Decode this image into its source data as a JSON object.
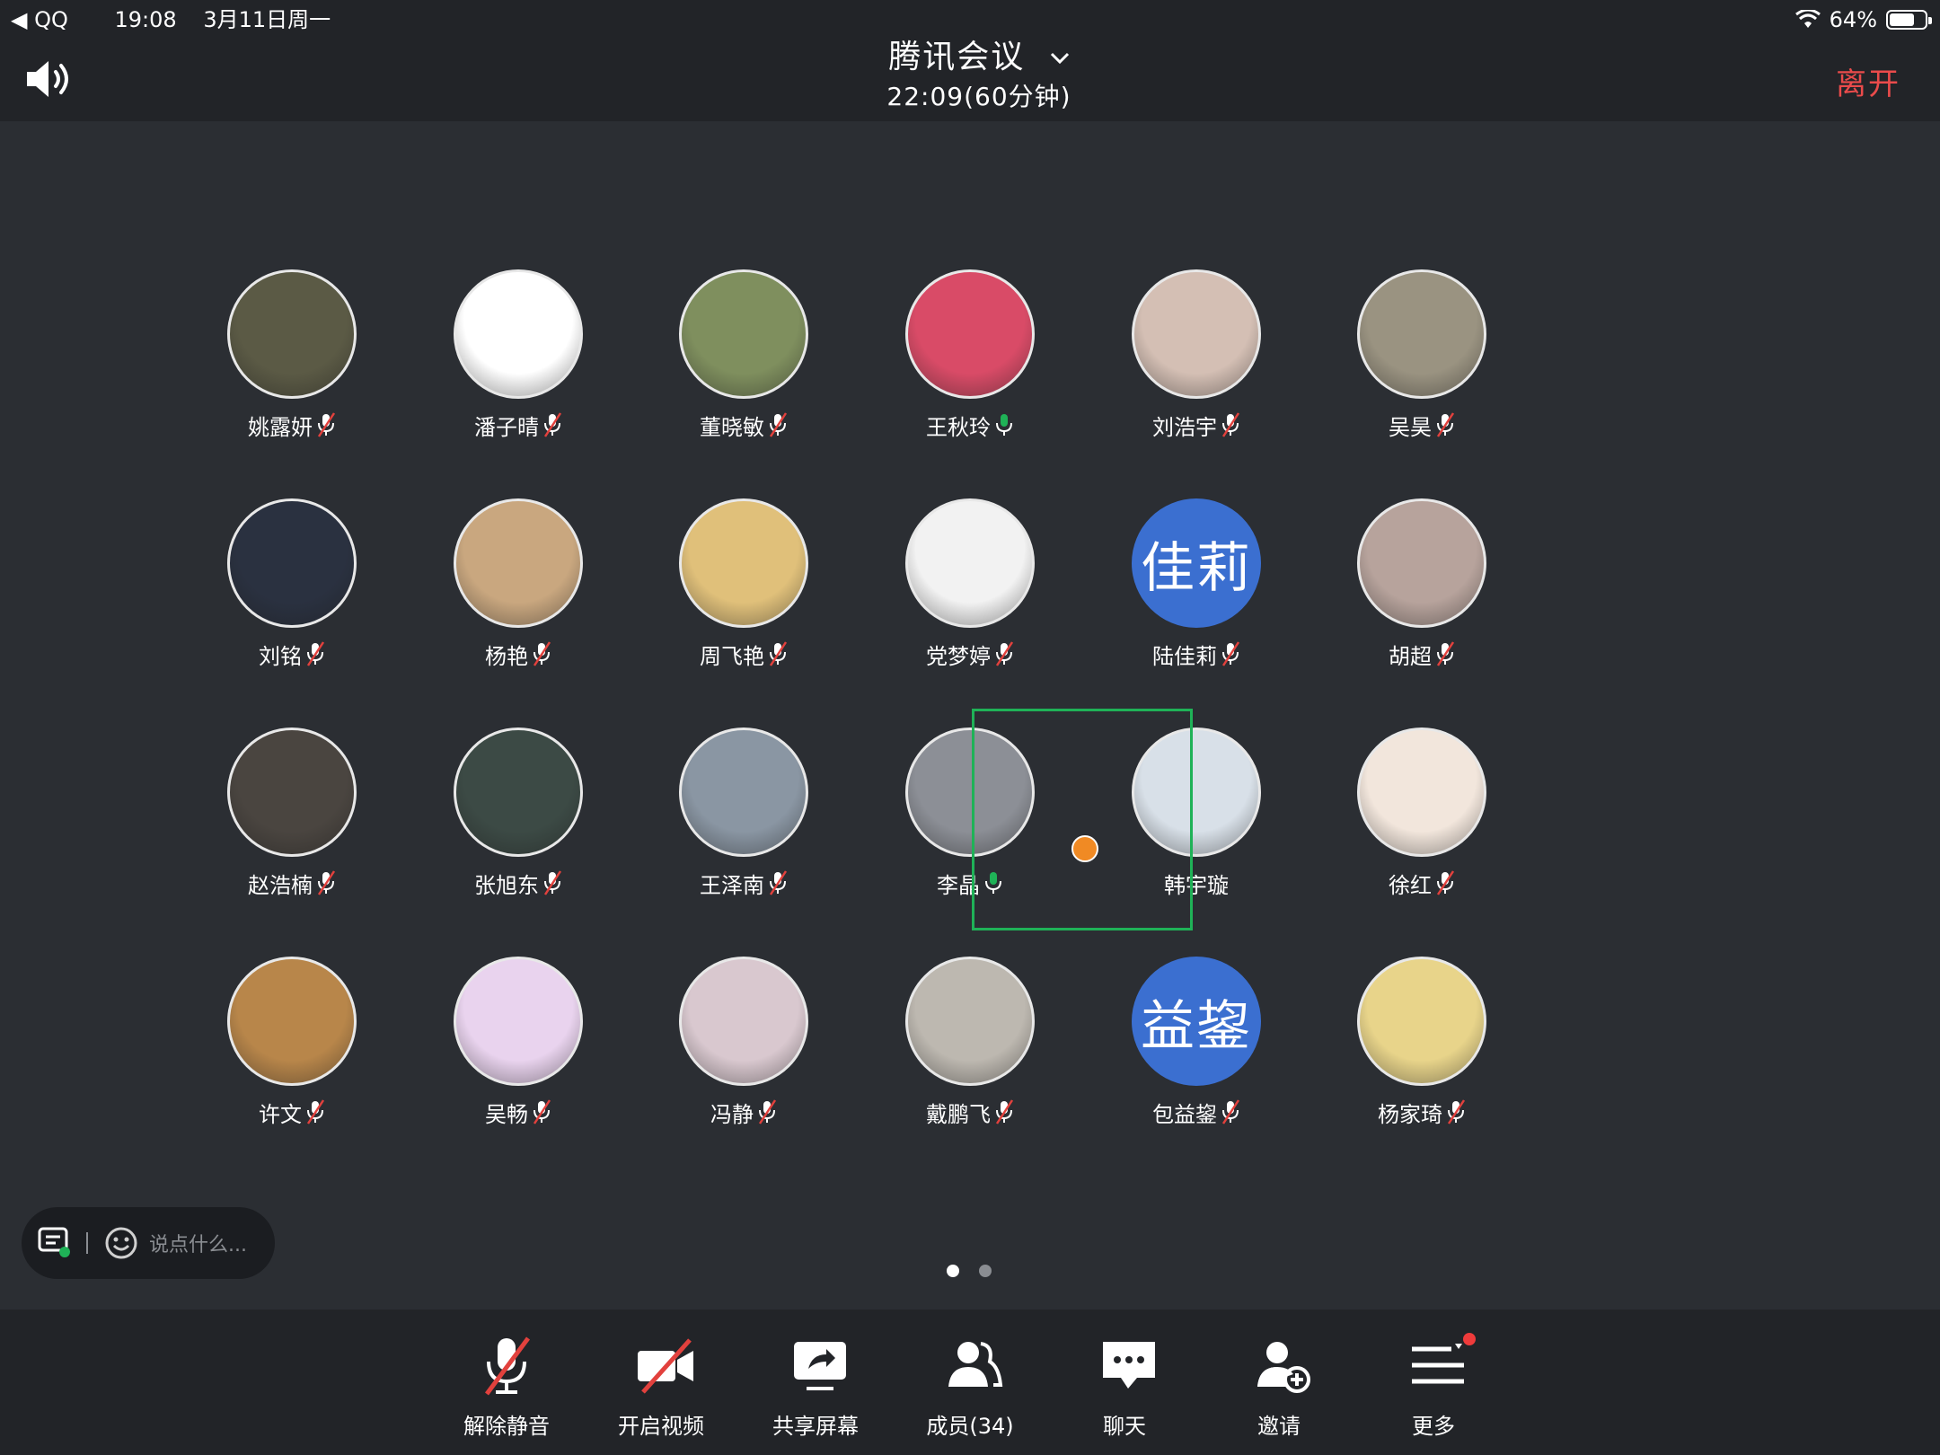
{
  "status_bar": {
    "back_app": "QQ",
    "time": "19:08",
    "date": "3月11日周一",
    "battery": "64%"
  },
  "header": {
    "title": "腾讯会议",
    "meeting_time": "22:09(60分钟)",
    "leave_label": "离开",
    "leave_color": "#ea4b4b"
  },
  "participants": [
    {
      "name": "姚露妍",
      "mic": "muted",
      "avatar": "photo-woman-outdoor",
      "bg": "#5b5a45"
    },
    {
      "name": "潘子晴",
      "mic": "muted",
      "avatar": "cartoon-kirby",
      "bg": "#ffffff"
    },
    {
      "name": "董晓敏",
      "mic": "muted",
      "avatar": "photo-child-polka",
      "bg": "#7f8f5e"
    },
    {
      "name": "王秋玲",
      "mic": "on",
      "avatar": "cartoon-lotso-bear",
      "bg": "#d94b67"
    },
    {
      "name": "刘浩宇",
      "mic": "muted",
      "avatar": "photo-woman-portrait",
      "bg": "#d4bfb4"
    },
    {
      "name": "吴昊",
      "mic": "muted",
      "avatar": "photo-teddy-bear",
      "bg": "#9a9381"
    },
    {
      "name": "刘铭",
      "mic": "muted",
      "avatar": "photo-jersey-30",
      "bg": "#2a3140"
    },
    {
      "name": "杨艳",
      "mic": "muted",
      "avatar": "photo-toddler",
      "bg": "#c9a77f"
    },
    {
      "name": "周飞艳",
      "mic": "muted",
      "avatar": "photo-woman-yellow",
      "bg": "#e0c07a"
    },
    {
      "name": "党梦婷",
      "mic": "muted",
      "avatar": "drawing-woman-sunglasses",
      "bg": "#f2f2f2"
    },
    {
      "name": "陆佳莉",
      "mic": "muted",
      "avatar_text": "佳莉",
      "bg": "#3b6fd0"
    },
    {
      "name": "胡超",
      "mic": "muted",
      "avatar": "photo-woman-flowers",
      "bg": "#b7a39c"
    },
    {
      "name": "赵浩楠",
      "mic": "muted",
      "avatar": "photo-man-phone-selfie",
      "bg": "#4a4540"
    },
    {
      "name": "张旭东",
      "mic": "muted",
      "avatar": "photo-dog-walk",
      "bg": "#3c4a45"
    },
    {
      "name": "王泽南",
      "mic": "muted",
      "avatar": "photo-man-mask",
      "bg": "#8a96a3"
    },
    {
      "name": "李晶",
      "mic": "on",
      "avatar": "photo-beach-runner",
      "bg": "#8c8f96",
      "active": true,
      "host": true
    },
    {
      "name": "韩宇璇",
      "mic": "none",
      "avatar": "cartoon-crayon-shin",
      "bg": "#d8e0e8"
    },
    {
      "name": "徐红",
      "mic": "muted",
      "avatar": "cartoon-girl-red",
      "bg": "#f2e6dc"
    },
    {
      "name": "许文",
      "mic": "muted",
      "avatar": "photo-lion-dog",
      "bg": "#b8864a"
    },
    {
      "name": "吴畅",
      "mic": "muted",
      "avatar": "cartoon-pink-bunny",
      "bg": "#e9d3ee"
    },
    {
      "name": "冯静",
      "mic": "muted",
      "avatar": "drawing-anime-girl",
      "bg": "#d9c8cf"
    },
    {
      "name": "戴鹏飞",
      "mic": "muted",
      "avatar": "photo-gallery-visitor",
      "bg": "#bdb8b0"
    },
    {
      "name": "包益鋆",
      "mic": "muted",
      "avatar_text": "益鋆",
      "bg": "#3b6fd0"
    },
    {
      "name": "杨家琦",
      "mic": "muted",
      "avatar": "photo-pikachu-plush",
      "bg": "#e8d48a"
    }
  ],
  "chat": {
    "placeholder": "说点什么..."
  },
  "pager": {
    "pages": 2,
    "current": 1
  },
  "toolbar": {
    "items": [
      {
        "label": "解除静音",
        "icon": "mic-muted-icon"
      },
      {
        "label": "开启视频",
        "icon": "video-off-icon"
      },
      {
        "label": "共享屏幕",
        "icon": "share-screen-icon"
      },
      {
        "label": "成员(34)",
        "icon": "members-icon"
      },
      {
        "label": "聊天",
        "icon": "chat-icon"
      },
      {
        "label": "邀请",
        "icon": "invite-icon"
      },
      {
        "label": "更多",
        "icon": "more-icon"
      }
    ]
  },
  "colors": {
    "background": "#2b2e33",
    "bar": "#222428",
    "active_speaker": "#1fb257",
    "mute_slash": "#e2413d",
    "mic_on": "#1fb257",
    "avatar_text_bg": "#3b6fd0"
  }
}
